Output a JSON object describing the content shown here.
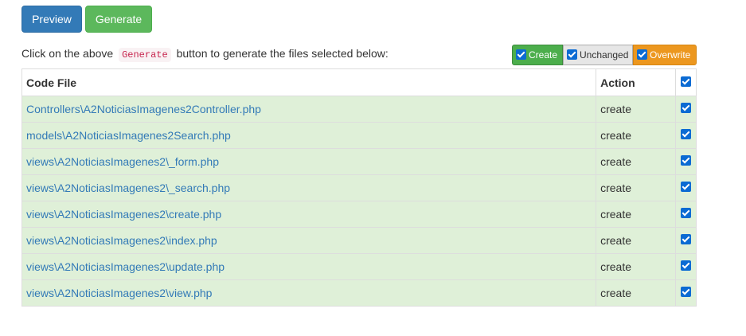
{
  "toolbar": {
    "preview_label": "Preview",
    "generate_label": "Generate"
  },
  "instruction": {
    "before": "Click on the above",
    "code": "Generate",
    "after": "button to generate the files selected below:"
  },
  "legend": {
    "create": "Create",
    "unchanged": "Unchanged",
    "overwrite": "Overwrite"
  },
  "table": {
    "headers": {
      "file": "Code File",
      "action": "Action"
    },
    "rows": [
      {
        "file": "Controllers\\A2NoticiasImagenes2Controller.php",
        "action": "create",
        "checked": true
      },
      {
        "file": "models\\A2NoticiasImagenes2Search.php",
        "action": "create",
        "checked": true
      },
      {
        "file": "views\\A2NoticiasImagenes2\\_form.php",
        "action": "create",
        "checked": true
      },
      {
        "file": "views\\A2NoticiasImagenes2\\_search.php",
        "action": "create",
        "checked": true
      },
      {
        "file": "views\\A2NoticiasImagenes2\\create.php",
        "action": "create",
        "checked": true
      },
      {
        "file": "views\\A2NoticiasImagenes2\\index.php",
        "action": "create",
        "checked": true
      },
      {
        "file": "views\\A2NoticiasImagenes2\\update.php",
        "action": "create",
        "checked": true
      },
      {
        "file": "views\\A2NoticiasImagenes2\\view.php",
        "action": "create",
        "checked": true
      }
    ]
  },
  "colors": {
    "preview": "#337ab7",
    "generate": "#5cb85c",
    "row_create": "#dff0d8",
    "legend_create": "#4cae4c",
    "legend_unchanged": "#e6e6e6",
    "legend_overwrite": "#ec971f",
    "link": "#337ab7"
  }
}
